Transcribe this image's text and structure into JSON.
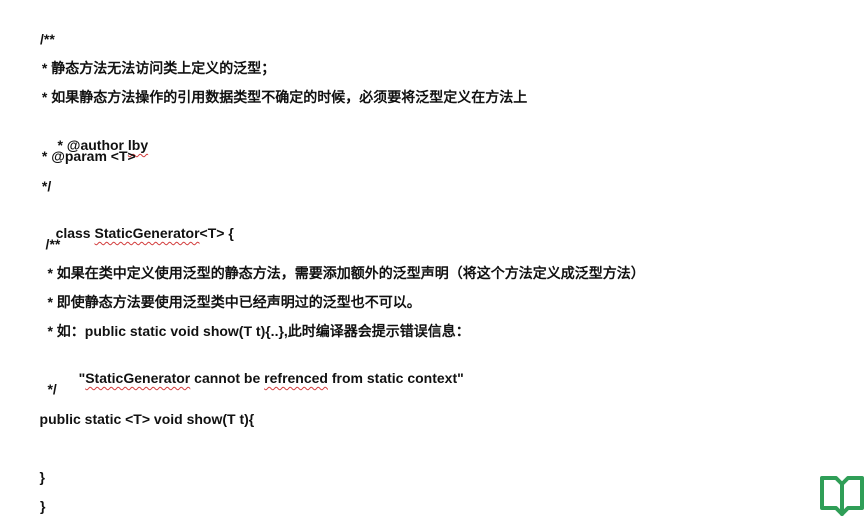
{
  "doc": {
    "lines": [
      {
        "text": "/**"
      },
      {
        "text": " * 静态方法无法访问类上定义的泛型；"
      },
      {
        "text": " * 如果静态方法操作的引用数据类型不确定的时候，必须要将泛型定义在方法上"
      },
      {
        "pre": " * @author ",
        "squig": "lby",
        "post": ""
      },
      {
        "text": " * @param <T>"
      },
      {
        "text": " */"
      },
      {
        "pre": "class ",
        "squig": "StaticGenerator",
        "post": "<T> {"
      },
      {
        "text": "    /**"
      },
      {
        "text": "     * 如果在类中定义使用泛型的静态方法，需要添加额外的泛型声明（将这个方法定义成泛型方法）"
      },
      {
        "text": "     * 即使静态方法要使用泛型类中已经声明过的泛型也不可以。"
      },
      {
        "text": "     * 如：public static void show(T t){..},此时编译器会提示错误信息："
      },
      {
        "pre": "         \"",
        "squig": "StaticGenerator",
        "mid": " cannot be ",
        "squig2": "refrenced",
        "post": " from static context\""
      },
      {
        "text": "     */"
      },
      {
        "text": "    public static <T> void show(T t){"
      },
      {
        "text": ""
      },
      {
        "text": "    }"
      },
      {
        "text": "}"
      }
    ]
  },
  "colors": {
    "logo": "#2f9e57",
    "squiggle": "#d23b3b"
  },
  "icons": {
    "logo": "book-logo-icon"
  }
}
